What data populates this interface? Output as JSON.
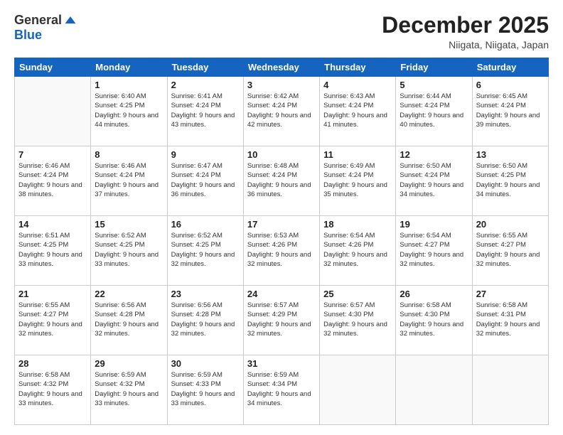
{
  "header": {
    "logo": {
      "general": "General",
      "blue": "Blue"
    },
    "title": "December 2025",
    "subtitle": "Niigata, Niigata, Japan"
  },
  "weekdays": [
    "Sunday",
    "Monday",
    "Tuesday",
    "Wednesday",
    "Thursday",
    "Friday",
    "Saturday"
  ],
  "weeks": [
    [
      {
        "day": "",
        "sunrise": "",
        "sunset": "",
        "daylight": ""
      },
      {
        "day": "1",
        "sunrise": "Sunrise: 6:40 AM",
        "sunset": "Sunset: 4:25 PM",
        "daylight": "Daylight: 9 hours and 44 minutes."
      },
      {
        "day": "2",
        "sunrise": "Sunrise: 6:41 AM",
        "sunset": "Sunset: 4:24 PM",
        "daylight": "Daylight: 9 hours and 43 minutes."
      },
      {
        "day": "3",
        "sunrise": "Sunrise: 6:42 AM",
        "sunset": "Sunset: 4:24 PM",
        "daylight": "Daylight: 9 hours and 42 minutes."
      },
      {
        "day": "4",
        "sunrise": "Sunrise: 6:43 AM",
        "sunset": "Sunset: 4:24 PM",
        "daylight": "Daylight: 9 hours and 41 minutes."
      },
      {
        "day": "5",
        "sunrise": "Sunrise: 6:44 AM",
        "sunset": "Sunset: 4:24 PM",
        "daylight": "Daylight: 9 hours and 40 minutes."
      },
      {
        "day": "6",
        "sunrise": "Sunrise: 6:45 AM",
        "sunset": "Sunset: 4:24 PM",
        "daylight": "Daylight: 9 hours and 39 minutes."
      }
    ],
    [
      {
        "day": "7",
        "sunrise": "Sunrise: 6:46 AM",
        "sunset": "Sunset: 4:24 PM",
        "daylight": "Daylight: 9 hours and 38 minutes."
      },
      {
        "day": "8",
        "sunrise": "Sunrise: 6:46 AM",
        "sunset": "Sunset: 4:24 PM",
        "daylight": "Daylight: 9 hours and 37 minutes."
      },
      {
        "day": "9",
        "sunrise": "Sunrise: 6:47 AM",
        "sunset": "Sunset: 4:24 PM",
        "daylight": "Daylight: 9 hours and 36 minutes."
      },
      {
        "day": "10",
        "sunrise": "Sunrise: 6:48 AM",
        "sunset": "Sunset: 4:24 PM",
        "daylight": "Daylight: 9 hours and 36 minutes."
      },
      {
        "day": "11",
        "sunrise": "Sunrise: 6:49 AM",
        "sunset": "Sunset: 4:24 PM",
        "daylight": "Daylight: 9 hours and 35 minutes."
      },
      {
        "day": "12",
        "sunrise": "Sunrise: 6:50 AM",
        "sunset": "Sunset: 4:24 PM",
        "daylight": "Daylight: 9 hours and 34 minutes."
      },
      {
        "day": "13",
        "sunrise": "Sunrise: 6:50 AM",
        "sunset": "Sunset: 4:25 PM",
        "daylight": "Daylight: 9 hours and 34 minutes."
      }
    ],
    [
      {
        "day": "14",
        "sunrise": "Sunrise: 6:51 AM",
        "sunset": "Sunset: 4:25 PM",
        "daylight": "Daylight: 9 hours and 33 minutes."
      },
      {
        "day": "15",
        "sunrise": "Sunrise: 6:52 AM",
        "sunset": "Sunset: 4:25 PM",
        "daylight": "Daylight: 9 hours and 33 minutes."
      },
      {
        "day": "16",
        "sunrise": "Sunrise: 6:52 AM",
        "sunset": "Sunset: 4:25 PM",
        "daylight": "Daylight: 9 hours and 32 minutes."
      },
      {
        "day": "17",
        "sunrise": "Sunrise: 6:53 AM",
        "sunset": "Sunset: 4:26 PM",
        "daylight": "Daylight: 9 hours and 32 minutes."
      },
      {
        "day": "18",
        "sunrise": "Sunrise: 6:54 AM",
        "sunset": "Sunset: 4:26 PM",
        "daylight": "Daylight: 9 hours and 32 minutes."
      },
      {
        "day": "19",
        "sunrise": "Sunrise: 6:54 AM",
        "sunset": "Sunset: 4:27 PM",
        "daylight": "Daylight: 9 hours and 32 minutes."
      },
      {
        "day": "20",
        "sunrise": "Sunrise: 6:55 AM",
        "sunset": "Sunset: 4:27 PM",
        "daylight": "Daylight: 9 hours and 32 minutes."
      }
    ],
    [
      {
        "day": "21",
        "sunrise": "Sunrise: 6:55 AM",
        "sunset": "Sunset: 4:27 PM",
        "daylight": "Daylight: 9 hours and 32 minutes."
      },
      {
        "day": "22",
        "sunrise": "Sunrise: 6:56 AM",
        "sunset": "Sunset: 4:28 PM",
        "daylight": "Daylight: 9 hours and 32 minutes."
      },
      {
        "day": "23",
        "sunrise": "Sunrise: 6:56 AM",
        "sunset": "Sunset: 4:28 PM",
        "daylight": "Daylight: 9 hours and 32 minutes."
      },
      {
        "day": "24",
        "sunrise": "Sunrise: 6:57 AM",
        "sunset": "Sunset: 4:29 PM",
        "daylight": "Daylight: 9 hours and 32 minutes."
      },
      {
        "day": "25",
        "sunrise": "Sunrise: 6:57 AM",
        "sunset": "Sunset: 4:30 PM",
        "daylight": "Daylight: 9 hours and 32 minutes."
      },
      {
        "day": "26",
        "sunrise": "Sunrise: 6:58 AM",
        "sunset": "Sunset: 4:30 PM",
        "daylight": "Daylight: 9 hours and 32 minutes."
      },
      {
        "day": "27",
        "sunrise": "Sunrise: 6:58 AM",
        "sunset": "Sunset: 4:31 PM",
        "daylight": "Daylight: 9 hours and 32 minutes."
      }
    ],
    [
      {
        "day": "28",
        "sunrise": "Sunrise: 6:58 AM",
        "sunset": "Sunset: 4:32 PM",
        "daylight": "Daylight: 9 hours and 33 minutes."
      },
      {
        "day": "29",
        "sunrise": "Sunrise: 6:59 AM",
        "sunset": "Sunset: 4:32 PM",
        "daylight": "Daylight: 9 hours and 33 minutes."
      },
      {
        "day": "30",
        "sunrise": "Sunrise: 6:59 AM",
        "sunset": "Sunset: 4:33 PM",
        "daylight": "Daylight: 9 hours and 33 minutes."
      },
      {
        "day": "31",
        "sunrise": "Sunrise: 6:59 AM",
        "sunset": "Sunset: 4:34 PM",
        "daylight": "Daylight: 9 hours and 34 minutes."
      },
      {
        "day": "",
        "sunrise": "",
        "sunset": "",
        "daylight": ""
      },
      {
        "day": "",
        "sunrise": "",
        "sunset": "",
        "daylight": ""
      },
      {
        "day": "",
        "sunrise": "",
        "sunset": "",
        "daylight": ""
      }
    ]
  ]
}
